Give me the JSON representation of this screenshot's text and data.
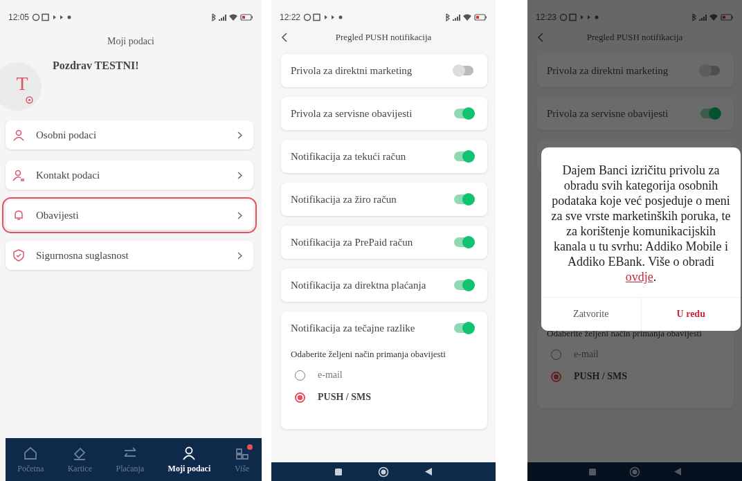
{
  "profile_screen": {
    "status_bar": {
      "time": "12:05"
    },
    "title": "Moji podaci",
    "avatar": {
      "initial": "T"
    },
    "greeting": "Pozdrav TESTNI!",
    "menu": [
      {
        "label": "Osobni podaci",
        "highlighted": false
      },
      {
        "label": "Kontakt podaci",
        "highlighted": false
      },
      {
        "label": "Obavijesti",
        "highlighted": true
      },
      {
        "label": "Sigurnosna suglasnost",
        "highlighted": false
      }
    ],
    "bottom_nav": [
      {
        "label": "Početna",
        "selected": false,
        "badge": false
      },
      {
        "label": "Kartice",
        "selected": false,
        "badge": false
      },
      {
        "label": "Plaćanja",
        "selected": false,
        "badge": false
      },
      {
        "label": "Moji podaci",
        "selected": true,
        "badge": false
      },
      {
        "label": "Više",
        "selected": false,
        "badge": true
      }
    ]
  },
  "notifications_screen": {
    "status_bar": {
      "time": "12:22"
    },
    "title": "Pregled PUSH notifikacija",
    "toggles": [
      {
        "label": "Privola za direktni marketing",
        "on": false
      },
      {
        "label": "Privola za servisne obavijesti",
        "on": true
      },
      {
        "label": "Notifikacija za tekući račun",
        "on": true
      },
      {
        "label": "Notifikacija za žiro račun",
        "on": true
      },
      {
        "label": "Notifikacija za PrePaid račun",
        "on": true
      },
      {
        "label": "Notifikacija za direktna plaćanja",
        "on": true
      },
      {
        "label": "Notifikacija za tečajne razlike",
        "on": true
      }
    ],
    "delivery": {
      "prompt": "Odaberite željeni način primanja obavijesti",
      "options": [
        {
          "label": "e-mail",
          "selected": false
        },
        {
          "label": "PUSH / SMS",
          "selected": true
        }
      ]
    }
  },
  "consent_screen": {
    "status_bar": {
      "time": "12:23"
    },
    "title": "Pregled PUSH notifikacija",
    "toggles": [
      {
        "label": "Privola za direktni marketing",
        "on": false
      },
      {
        "label": "Privola za servisne obavijesti",
        "on": true
      }
    ],
    "dialog": {
      "text": "Dajem Banci izričitu privolu za obradu svih kategorija osobnih podataka koje već posjeduje o meni za sve vrste marketinških poruka, te za korištenje komunikacijskih kanala u tu svrhu: Addiko Mobile i Addiko EBank. Više o obradi ",
      "link": "ovdje",
      "text_end": ".",
      "buttons": [
        {
          "label": "Zatvorite",
          "kind": "secondary"
        },
        {
          "label": "U redu",
          "kind": "primary"
        }
      ]
    },
    "delivery": {
      "prompt": "Odaberite željeni način primanja obavijesti",
      "options": [
        {
          "label": "e-mail",
          "selected": false
        },
        {
          "label": "PUSH / SMS",
          "selected": true
        }
      ]
    }
  }
}
